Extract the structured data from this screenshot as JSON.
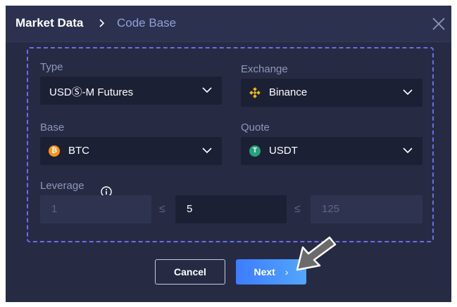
{
  "header": {
    "breadcrumb_root": "Market Data",
    "breadcrumb_current": "Code Base"
  },
  "form": {
    "type": {
      "label": "Type",
      "value": "USDⓈ-M Futures"
    },
    "exchange": {
      "label": "Exchange",
      "value": "Binance",
      "icon": "binance-icon"
    },
    "base": {
      "label": "Base",
      "value": "BTC",
      "icon": "bitcoin-icon"
    },
    "quote": {
      "label": "Quote",
      "value": "USDT",
      "icon": "tether-icon"
    },
    "leverage": {
      "label": "Leverage",
      "min": "1",
      "value": "5",
      "max": "125",
      "separator": "≤"
    }
  },
  "actions": {
    "cancel_label": "Cancel",
    "next_label": "Next",
    "next_arrow": "›"
  },
  "colors": {
    "dialog_bg": "#262b43",
    "dashed_border": "#6b6bf0",
    "next_button": "#4a90ff",
    "binance_yellow": "#f0b90b",
    "btc_orange": "#f7931a",
    "usdt_green": "#26a17b"
  }
}
